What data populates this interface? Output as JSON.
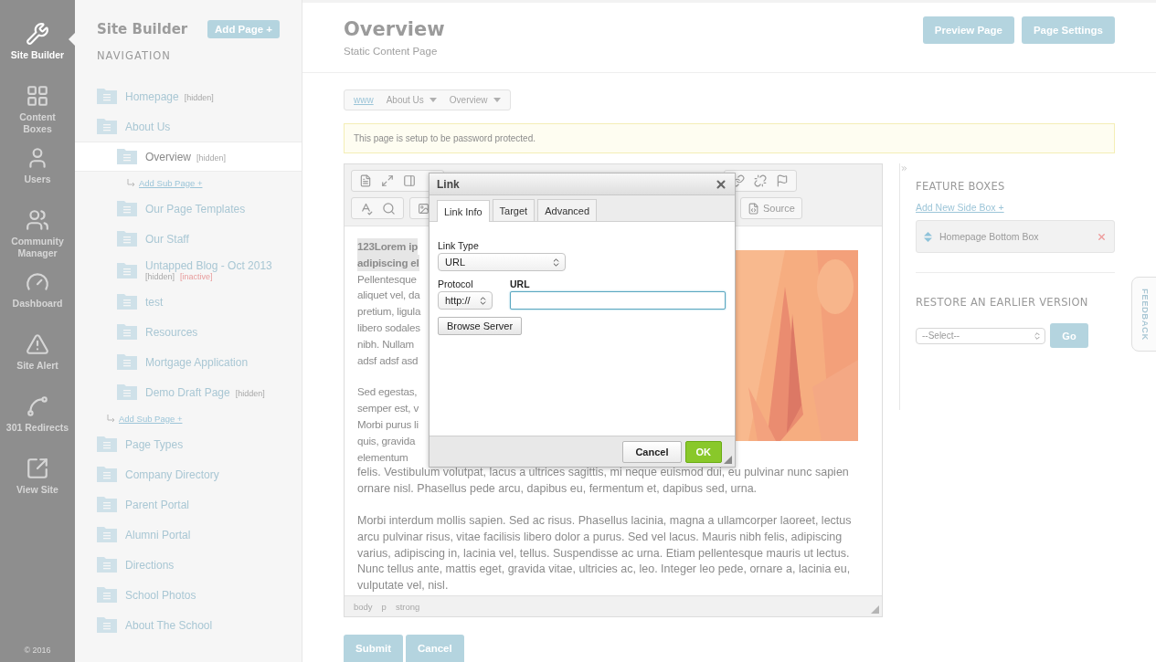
{
  "rail": {
    "items": [
      {
        "label": "Site Builder",
        "selected": true
      },
      {
        "label": "Content Boxes",
        "selected": false
      },
      {
        "label": "Users",
        "selected": false
      },
      {
        "label": "Community Manager",
        "selected": false
      },
      {
        "label": "Dashboard",
        "selected": false
      },
      {
        "label": "Site Alert",
        "selected": false
      },
      {
        "label": "301 Redirects",
        "selected": false
      },
      {
        "label": "View Site",
        "selected": false
      }
    ],
    "copyright": "© 2016"
  },
  "nav": {
    "title": "Site Builder",
    "add_button": "Add Page +",
    "heading": "NAVIGATION",
    "items": [
      {
        "label": "Homepage",
        "selected": false,
        "tags": [
          {
            "text": "[hidden]",
            "kind": "hidden"
          }
        ]
      },
      {
        "label": "About Us",
        "selected": false,
        "add_link": "Add Sub Page +",
        "children": [
          {
            "label": "Overview",
            "selected": true,
            "tags": [
              {
                "text": "[hidden]",
                "kind": "hidden"
              }
            ],
            "add_link": "Add Sub Page +"
          },
          {
            "label": "Our Page Templates",
            "selected": false
          },
          {
            "label": "Our Staff",
            "selected": false
          },
          {
            "label": "Untapped Blog - Oct 2013",
            "selected": false,
            "tags": [
              {
                "text": "[hidden]",
                "kind": "hidden"
              },
              {
                "text": "[inactive]",
                "kind": "inactive"
              }
            ]
          },
          {
            "label": "test",
            "selected": false
          },
          {
            "label": "Resources",
            "selected": false
          },
          {
            "label": "Mortgage Application",
            "selected": false
          },
          {
            "label": "Demo Draft Page",
            "selected": false,
            "tags": [
              {
                "text": "[hidden]",
                "kind": "hidden"
              }
            ]
          }
        ]
      },
      {
        "label": "Page Types",
        "selected": false
      },
      {
        "label": "Company Directory",
        "selected": false
      },
      {
        "label": "Parent Portal",
        "selected": false
      },
      {
        "label": "Alumni Portal",
        "selected": false
      },
      {
        "label": "Directions",
        "selected": false
      },
      {
        "label": "School Photos",
        "selected": false
      },
      {
        "label": "About The School",
        "selected": false
      }
    ]
  },
  "header": {
    "title": "Overview",
    "subtitle": "Static Content Page",
    "buttons": [
      "Preview Page",
      "Page Settings"
    ]
  },
  "breadcrumb": [
    {
      "label": "www",
      "kind": "link"
    },
    {
      "label": "About Us",
      "kind": "menu"
    },
    {
      "label": "Overview",
      "kind": "menu"
    }
  ],
  "alert": "This page is setup to be password protected.",
  "editor": {
    "source_button": "Source",
    "left_lines": [
      {
        "text": "123Lorem ip",
        "bold": true
      },
      {
        "text": "adipiscing el",
        "bold": true
      },
      {
        "text": "Pellentesque",
        "bold": false
      },
      {
        "text": "aliquet vel, da",
        "bold": false
      },
      {
        "text": "pretium, ligula",
        "bold": false
      },
      {
        "text": "libero sodales",
        "bold": false
      },
      {
        "text": "nibh. Nullam",
        "bold": false
      },
      {
        "text": "adsf adsf asd",
        "bold": false
      }
    ],
    "left_lines_2": [
      "Sed egestas,",
      "semper est, v",
      "Morbi purus li",
      "quis, gravida",
      "elementum"
    ],
    "paragraphs": [
      "felis. Vestibulum volutpat, lacus a ultrices sagittis, mi neque euismod dui, eu pulvinar nunc sapien ornare nisl. Phasellus pede arcu, dapibus eu, fermentum et, dapibus sed, urna.",
      "Morbi interdum mollis sapien. Sed ac risus. Phasellus lacinia, magna a ullamcorper laoreet, lectus arcu pulvinar risus, vitae facilisis libero dolor a purus. Sed vel lacus. Mauris nibh felis, adipiscing varius, adipiscing in, lacinia vel, tellus. Suspendisse ac urna. Etiam pellentesque mauris ut lectus. Nunc tellus ante, mattis eget, gravida vitae, ultricies ac, leo. Integer leo pede, ornare a, lacinia eu, vulputate vel, nisl."
    ],
    "path": [
      "body",
      "p",
      "strong"
    ]
  },
  "dialog": {
    "title": "Link",
    "tabs": [
      {
        "label": "Link Info",
        "selected": true
      },
      {
        "label": "Target",
        "selected": false
      },
      {
        "label": "Advanced",
        "selected": false
      }
    ],
    "link_type": {
      "label": "Link Type",
      "value": "URL"
    },
    "protocol": {
      "label": "Protocol",
      "value": "http://"
    },
    "url": {
      "label": "URL",
      "focused": true
    },
    "browse_button": "Browse Server",
    "buttons": [
      {
        "label": "Cancel",
        "kind": "secondary"
      },
      {
        "label": "OK",
        "kind": "primary"
      }
    ]
  },
  "side": {
    "feature_heading": "FEATURE BOXES",
    "add_link": "Add New Side Box +",
    "boxes": [
      "Homepage Bottom Box"
    ],
    "restore_heading": "RESTORE AN EARLIER VERSION",
    "select": "--Select--",
    "go_button": "Go"
  },
  "feedback": "FEEDBACK",
  "form_buttons": [
    "Submit",
    "Cancel"
  ]
}
